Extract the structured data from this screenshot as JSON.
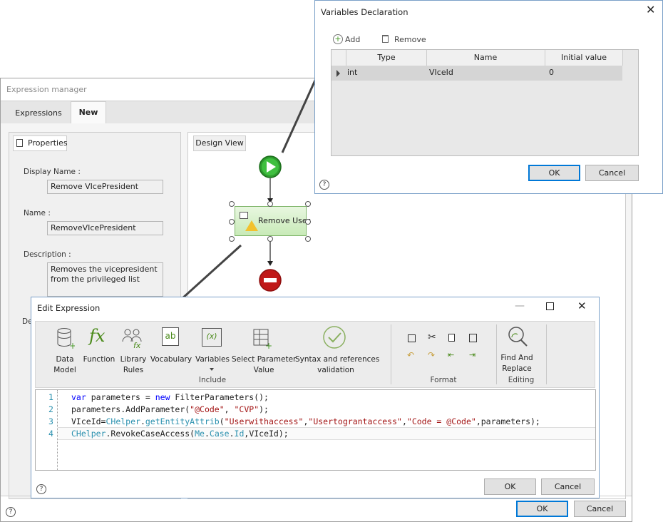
{
  "expr_manager": {
    "title": "Expression manager",
    "tabs": [
      "Expressions",
      "New"
    ],
    "properties_tab": "Properties",
    "design_tab": "Design View",
    "display_name_label": "Display Name :",
    "display_name": "Remove VIcePresident",
    "name_label": "Name :",
    "name": "RemoveVIcePresident",
    "description_label": "Description :",
    "description": "Removes the vicepresident from the privileged list",
    "de_label": "De",
    "ok": "OK",
    "cancel": "Cancel",
    "help": "?"
  },
  "design": {
    "task_label": "Remove User"
  },
  "variables": {
    "title": "Variables Declaration",
    "add": "Add",
    "remove": "Remove",
    "columns": [
      "Type",
      "Name",
      "Initial value"
    ],
    "rows": [
      {
        "type": "int",
        "name": "VIceId",
        "value": "0"
      }
    ],
    "ok": "OK",
    "cancel": "Cancel",
    "help": "?"
  },
  "edit_expression": {
    "title": "Edit Expression",
    "toolbar": {
      "data_model": "Data\nModel",
      "function": "Function",
      "library_rules": "Library\nRules",
      "vocabulary": "Vocabulary",
      "variables": "Variables",
      "select_parameter": "Select Parameter\nValue",
      "syntax": "Syntax and references\nvalidation",
      "include_group": "Include",
      "format_group": "Format",
      "find_replace": "Find And\nReplace",
      "editing_group": "Editing"
    },
    "line_numbers": [
      "1",
      "2",
      "3",
      "4"
    ],
    "ok": "OK",
    "cancel": "Cancel",
    "help": "?"
  },
  "colors": {
    "keyword": "#0000ff",
    "string": "#a31515",
    "type": "#2b91af",
    "accent": "#0078d7"
  }
}
